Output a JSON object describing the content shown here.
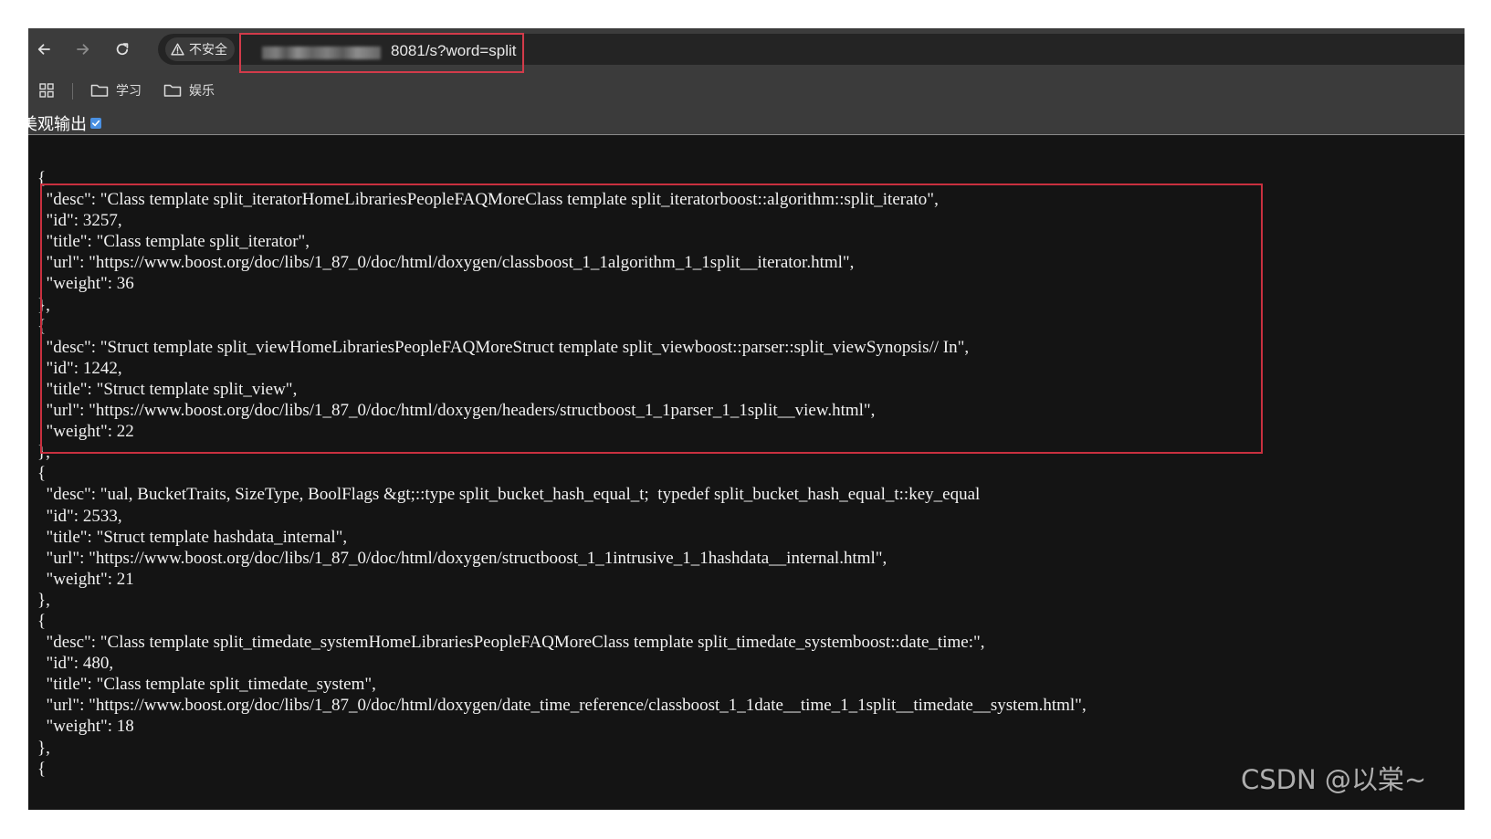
{
  "browser": {
    "security_label": "不安全",
    "url_visible": "8081/s?word=split",
    "bookmarks": [
      {
        "label": "学习",
        "icon": "folder-icon"
      },
      {
        "label": "娱乐",
        "icon": "folder-icon"
      }
    ]
  },
  "page": {
    "pretty_print_label": "美观输出",
    "pretty_print_checked": true
  },
  "json_lines": [
    "{",
    "  \"desc\": \"Class template split_iteratorHomeLibrariesPeopleFAQMoreClass template split_iteratorboost::algorithm::split_iterato\",",
    "  \"id\": 3257,",
    "  \"title\": \"Class template split_iterator\",",
    "  \"url\": \"https://www.boost.org/doc/libs/1_87_0/doc/html/doxygen/classboost_1_1algorithm_1_1split__iterator.html\",",
    "  \"weight\": 36",
    "},",
    "{",
    "  \"desc\": \"Struct template split_viewHomeLibrariesPeopleFAQMoreStruct template split_viewboost::parser::split_viewSynopsis// In\",",
    "  \"id\": 1242,",
    "  \"title\": \"Struct template split_view\",",
    "  \"url\": \"https://www.boost.org/doc/libs/1_87_0/doc/html/doxygen/headers/structboost_1_1parser_1_1split__view.html\",",
    "  \"weight\": 22",
    "},",
    "{",
    "  \"desc\": \"ual, BucketTraits, SizeType, BoolFlags &gt;::type split_bucket_hash_equal_t;  typedef split_bucket_hash_equal_t::key_equal",
    "  \"id\": 2533,",
    "  \"title\": \"Struct template hashdata_internal\",",
    "  \"url\": \"https://www.boost.org/doc/libs/1_87_0/doc/html/doxygen/structboost_1_1intrusive_1_1hashdata__internal.html\",",
    "  \"weight\": 21",
    "},",
    "{",
    "  \"desc\": \"Class template split_timedate_systemHomeLibrariesPeopleFAQMoreClass template split_timedate_systemboost::date_time:\",",
    "  \"id\": 480,",
    "  \"title\": \"Class template split_timedate_system\",",
    "  \"url\": \"https://www.boost.org/doc/libs/1_87_0/doc/html/doxygen/date_time_reference/classboost_1_1date__time_1_1split__timedate__system.html\",",
    "  \"weight\": 18",
    "},",
    "{"
  ],
  "watermark": "CSDN @以棠~",
  "colors": {
    "page_bg": "#141414",
    "toolbar_bg": "#3c3c3c",
    "highlight_border": "#c9303f",
    "checkbox_accent": "#4a90e2"
  }
}
